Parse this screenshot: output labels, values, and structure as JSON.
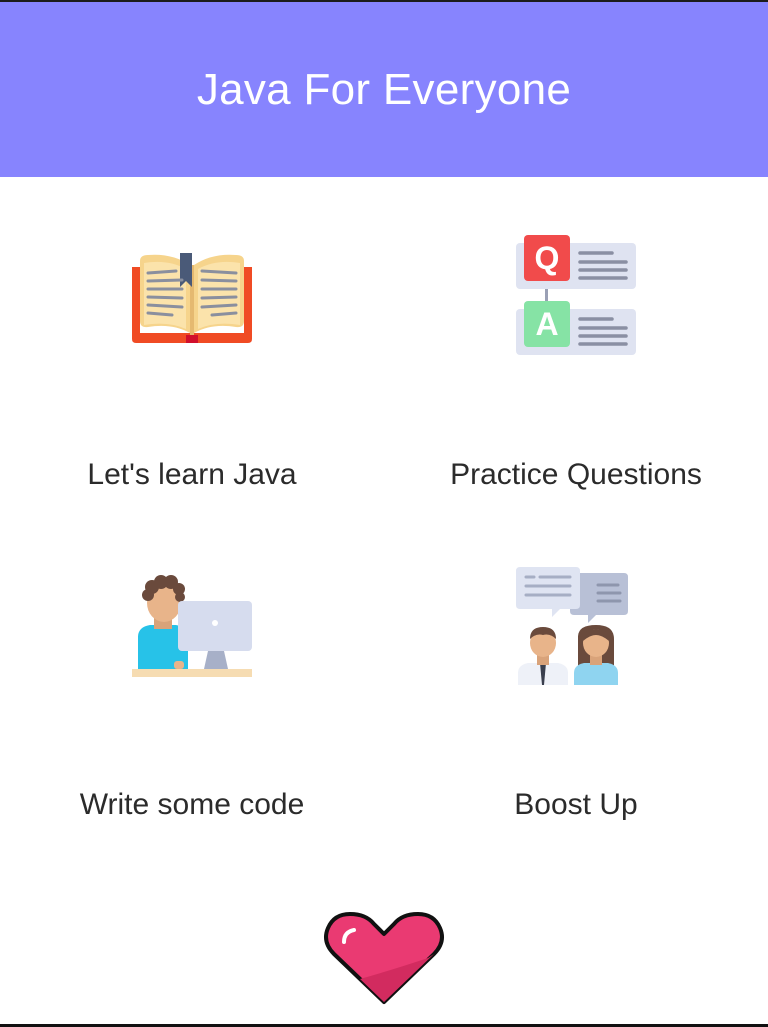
{
  "header": {
    "title": "Java For Everyone",
    "background": "#8784fe",
    "title_color": "#ffffff"
  },
  "menu": {
    "items": [
      {
        "label": "Let's learn Java",
        "icon": "open-book-icon"
      },
      {
        "label": "Practice Questions",
        "icon": "qa-icon"
      },
      {
        "label": "Write some code",
        "icon": "developer-computer-icon"
      },
      {
        "label": "Boost Up",
        "icon": "discussion-people-icon"
      }
    ]
  },
  "footer": {
    "icon": "heart-icon",
    "heart_color": "#ea3a72"
  }
}
